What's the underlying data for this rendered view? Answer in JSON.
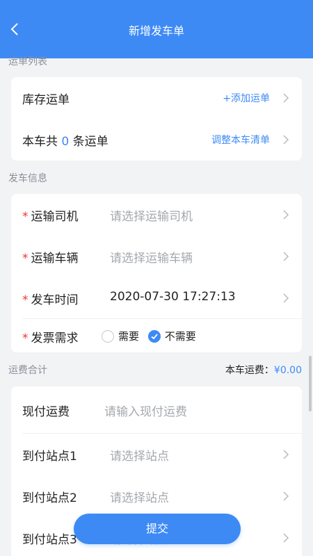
{
  "header": {
    "title": "新增发车单",
    "back_icon": "chevron-left-icon"
  },
  "waybill_section": {
    "title": "运单列表",
    "stock_label": "库存运单",
    "add_action": "+添加运单",
    "count_prefix": "本车共",
    "count": "0",
    "count_suffix": "条运单",
    "adjust_action": "调整本车清单"
  },
  "departure_section": {
    "title": "发车信息",
    "required_mark": "*",
    "driver_label": "运输司机",
    "driver_placeholder": "请选择运输司机",
    "vehicle_label": "运输车辆",
    "vehicle_placeholder": "请选择运输车辆",
    "time_label": "发车时间",
    "time_value": "2020-07-30 17:27:13",
    "invoice_label": "发票需求",
    "invoice_options": [
      {
        "label": "需要",
        "checked": false
      },
      {
        "label": "不需要",
        "checked": true
      }
    ]
  },
  "freight_section": {
    "title": "运费合计",
    "total_label": "本车运费：",
    "total_value": "¥0.00",
    "prepaid_label": "现付运费",
    "prepaid_placeholder": "请输入现付运费",
    "station1_label": "到付站点1",
    "station2_label": "到付站点2",
    "station3_label": "到付站点3",
    "station_placeholder": "请选择站点"
  },
  "submit_label": "提交",
  "colors": {
    "accent": "#3d8af5",
    "required": "#ee3333",
    "background": "#f2f3f5"
  }
}
